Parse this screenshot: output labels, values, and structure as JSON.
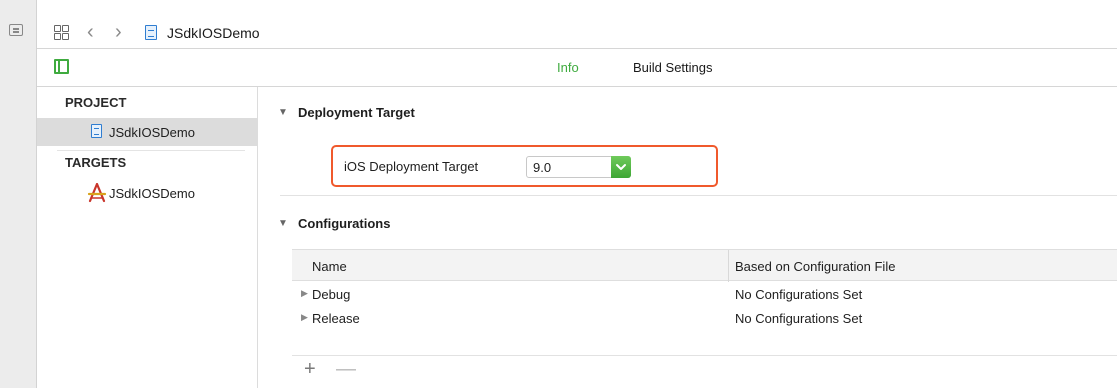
{
  "jumpbar": {
    "back_glyph": "‹",
    "forward_glyph": "›",
    "file_icon": "project-file-icon",
    "title": "JSdkIOSDemo"
  },
  "tabs": {
    "info_label": "Info",
    "build_settings_label": "Build Settings",
    "active": "Info",
    "active_color": "#3fab3f"
  },
  "sidebar": {
    "project_heading": "PROJECT",
    "project_item": "JSdkIOSDemo",
    "targets_heading": "TARGETS",
    "target_item": "JSdkIOSDemo"
  },
  "deployment": {
    "section_title": "Deployment Target",
    "field_label": "iOS Deployment Target",
    "field_value": "9.0",
    "highlight_color": "#f0592c"
  },
  "configurations": {
    "section_title": "Configurations",
    "columns": [
      "Name",
      "Based on Configuration File"
    ],
    "rows": [
      {
        "name": "Debug",
        "file": "No Configurations Set"
      },
      {
        "name": "Release",
        "file": "No Configurations Set"
      }
    ],
    "add_glyph": "+",
    "remove_glyph": "—"
  }
}
